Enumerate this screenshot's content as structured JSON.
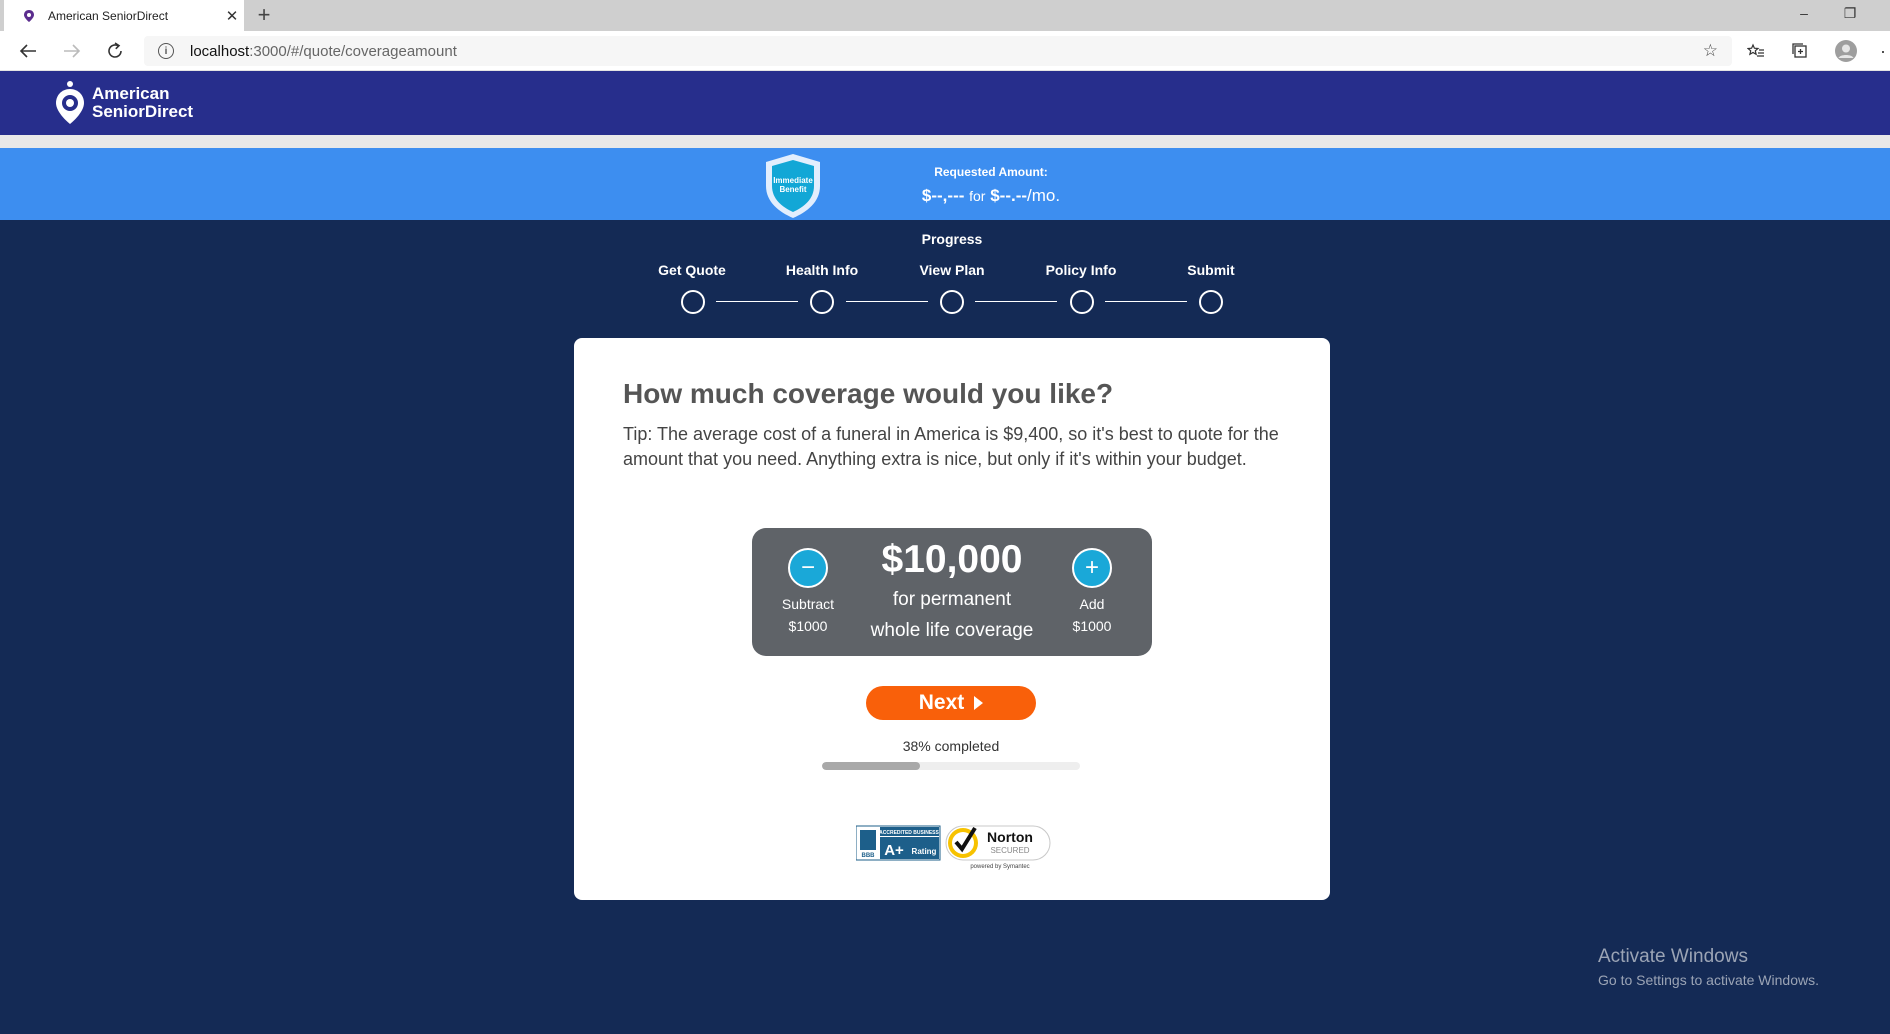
{
  "browser": {
    "tab_title": "American SeniorDirect",
    "url_host": "localhost",
    "url_path": ":3000/#/quote/coverageamount"
  },
  "site": {
    "logo_line1": "American",
    "logo_line2": "SeniorDirect"
  },
  "band": {
    "shield_line1": "Immediate",
    "shield_line2": "Benefit",
    "requested_label": "Requested Amount:",
    "amount": "$--,---",
    "for_word": "for",
    "premium": "$--.--",
    "per": "/mo."
  },
  "progress": {
    "title": "Progress",
    "steps": [
      {
        "label": "Get Quote"
      },
      {
        "label": "Health Info"
      },
      {
        "label": "View Plan"
      },
      {
        "label": "Policy Info"
      },
      {
        "label": "Submit"
      }
    ]
  },
  "card": {
    "title": "How much coverage would you like?",
    "tip": "Tip: The average cost of a funeral in America is $9,400, so it's best to quote for the amount that you need. Anything extra is nice, but only if it's within your budget.",
    "coverage_amount": "$10,000",
    "coverage_line1": "for permanent",
    "coverage_line2": "whole life coverage",
    "subtract_label": "Subtract",
    "subtract_amount": "$1000",
    "add_label": "Add",
    "add_amount": "$1000",
    "next_label": "Next",
    "completed_text": "38% completed",
    "completed_fraction": 0.38
  },
  "badges": {
    "bbb_top": "ACCREDITED BUSINESS",
    "bbb_grade": "A+",
    "bbb_rating": "Rating",
    "bbb_logo": "BBB",
    "norton_title": "Norton",
    "norton_secured": "SECURED",
    "norton_powered": "powered by Symantec"
  },
  "watermark": {
    "title": "Activate Windows",
    "subtitle": "Go to Settings to activate Windows."
  },
  "colors": {
    "header": "#272e8c",
    "band": "#3d8ef0",
    "page_bg": "#142a55",
    "next_button": "#f9600a",
    "stepper_buttons": "#1aa8d8"
  }
}
